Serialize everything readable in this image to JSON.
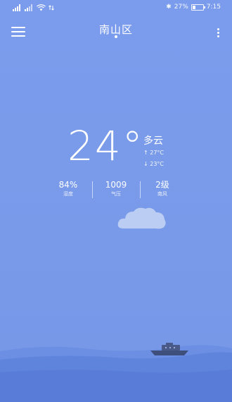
{
  "status_bar": {
    "battery": "27%",
    "time": "7:15"
  },
  "header": {
    "city": "南山区"
  },
  "weather": {
    "temperature": "24°",
    "condition": "多云",
    "high": "↑ 27°C",
    "low": "↓ 23°C"
  },
  "stats": [
    {
      "value": "84%",
      "label": "湿度"
    },
    {
      "value": "1009",
      "label": "气压"
    },
    {
      "value": "2级",
      "label": "南风"
    }
  ],
  "colors": {
    "background": "#7a9bec",
    "wave_back": "#6b8ee2",
    "wave_front": "#5a7fd8",
    "boat": "#4a5a88"
  }
}
